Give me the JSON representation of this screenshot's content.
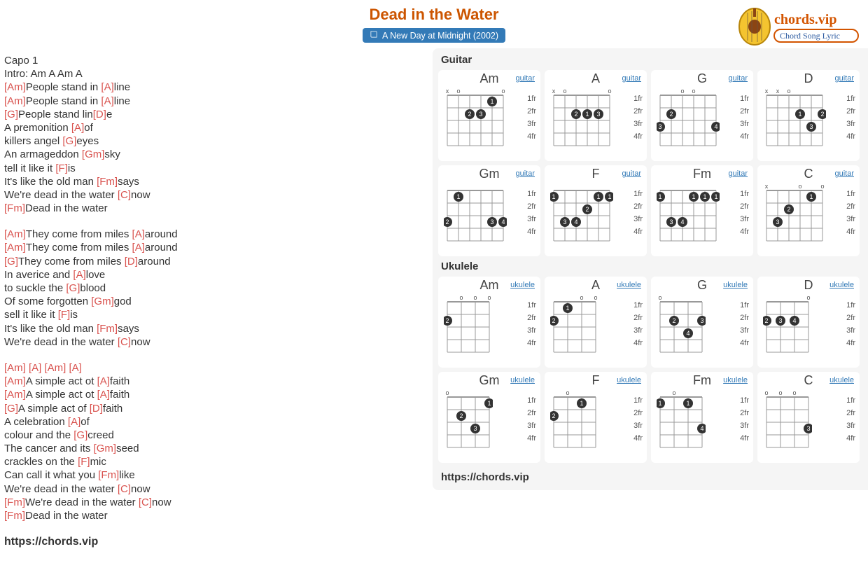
{
  "song": {
    "title": "Dead in the Water",
    "album_line": "A New Day at Midnight (2002)",
    "capo": "Capo 1",
    "intro": "Intro: Am A Am A"
  },
  "verses": [
    [
      {
        "pre": "",
        "chord": "[Am]",
        "post": "People stand in ",
        "chord2": "[A]",
        "post2": "line"
      },
      {
        "pre": "",
        "chord": "[Am]",
        "post": "People stand in ",
        "chord2": "[A]",
        "post2": "line"
      },
      {
        "pre": "",
        "chord": "[G]",
        "post": "People stand lin",
        "chord2": "[D]",
        "post2": "e"
      },
      {
        "pre": "A premonition ",
        "chord": "[A]",
        "post": "of"
      },
      {
        "pre": "killers angel ",
        "chord": "[G]",
        "post": "eyes"
      },
      {
        "pre": "An armageddon ",
        "chord": "[Gm]",
        "post": "sky"
      },
      {
        "pre": "tell it like it ",
        "chord": "[F]",
        "post": "is"
      },
      {
        "pre": "It's like the old man ",
        "chord": "[Fm]",
        "post": "says"
      },
      {
        "pre": "We're dead in the water ",
        "chord": "[C]",
        "post": "now"
      },
      {
        "pre": "",
        "chord": "[Fm]",
        "post": "Dead in the water"
      }
    ],
    [
      {
        "pre": "",
        "chord": "[Am]",
        "post": "They come from miles ",
        "chord2": "[A]",
        "post2": "around"
      },
      {
        "pre": "",
        "chord": "[Am]",
        "post": "They come from miles ",
        "chord2": "[A]",
        "post2": "around"
      },
      {
        "pre": "",
        "chord": "[G]",
        "post": "They come from miles ",
        "chord2": "[D]",
        "post2": "around"
      },
      {
        "pre": "In averice and ",
        "chord": "[A]",
        "post": "love"
      },
      {
        "pre": "to suckle the ",
        "chord": "[G]",
        "post": "blood"
      },
      {
        "pre": "Of some forgotten ",
        "chord": "[Gm]",
        "post": "god"
      },
      {
        "pre": "sell it like it ",
        "chord": "[F]",
        "post": "is"
      },
      {
        "pre": "It's like the old man ",
        "chord": "[Fm]",
        "post": "says"
      },
      {
        "pre": "We're dead in the water ",
        "chord": "[C]",
        "post": "now"
      }
    ],
    [
      {
        "pre": "",
        "chord": "[Am] [A] [Am] [A]",
        "post": ""
      },
      {
        "pre": "",
        "chord": "[Am]",
        "post": "A simple act ot ",
        "chord2": "[A]",
        "post2": "faith"
      },
      {
        "pre": "",
        "chord": "[Am]",
        "post": "A simple act ot ",
        "chord2": "[A]",
        "post2": "faith"
      },
      {
        "pre": "",
        "chord": "[G]",
        "post": "A simple act of ",
        "chord2": "[D]",
        "post2": "faith"
      },
      {
        "pre": "A celebration ",
        "chord": "[A]",
        "post": "of"
      },
      {
        "pre": "colour and the ",
        "chord": "[G]",
        "post": "creed"
      },
      {
        "pre": "The cancer and its ",
        "chord": "[Gm]",
        "post": "seed"
      },
      {
        "pre": "crackles on the ",
        "chord": "[F]",
        "post": "mic"
      },
      {
        "pre": "Can call it what you ",
        "chord": "[Fm]",
        "post": "like"
      },
      {
        "pre": "We're dead in the water ",
        "chord": "[C]",
        "post": "now"
      },
      {
        "pre": "",
        "chord": "[Fm]",
        "post": "We're dead in the water ",
        "chord2": "[C]",
        "post2": "now"
      },
      {
        "pre": "",
        "chord": "[Fm]",
        "post": "Dead in the water"
      }
    ]
  ],
  "footer_url": "https://chords.vip",
  "panel": {
    "guitar_heading": "Guitar",
    "ukulele_heading": "Ukulele",
    "url": "https://chords.vip",
    "type_guitar": "guitar",
    "type_ukulele": "ukulele",
    "fret_labels": [
      "1fr",
      "2fr",
      "3fr",
      "4fr"
    ]
  },
  "guitar_chords": [
    {
      "name": "Am",
      "nut": [
        "x",
        "o",
        "",
        "",
        "",
        "o"
      ],
      "dots": [
        {
          "s": 2,
          "f": 1,
          "n": "1"
        },
        {
          "s": 3,
          "f": 2,
          "n": "3"
        },
        {
          "s": 4,
          "f": 2,
          "n": "2"
        }
      ]
    },
    {
      "name": "A",
      "nut": [
        "x",
        "o",
        "",
        "",
        "",
        "o"
      ],
      "dots": [
        {
          "s": 2,
          "f": 2,
          "n": "3"
        },
        {
          "s": 3,
          "f": 2,
          "n": "1"
        },
        {
          "s": 4,
          "f": 2,
          "n": "2"
        }
      ]
    },
    {
      "name": "G",
      "nut": [
        "",
        "",
        "o",
        "o",
        "",
        ""
      ],
      "dots": [
        {
          "s": 5,
          "f": 2,
          "n": "2"
        },
        {
          "s": 6,
          "f": 3,
          "n": "3"
        },
        {
          "s": 1,
          "f": 3,
          "n": "4"
        }
      ]
    },
    {
      "name": "D",
      "nut": [
        "x",
        "x",
        "o",
        "",
        "",
        ""
      ],
      "dots": [
        {
          "s": 3,
          "f": 2,
          "n": "1"
        },
        {
          "s": 1,
          "f": 2,
          "n": "2"
        },
        {
          "s": 2,
          "f": 3,
          "n": "3"
        }
      ]
    },
    {
      "name": "Gm",
      "nut": [
        "",
        "",
        "",
        "",
        "",
        ""
      ],
      "dots": [
        {
          "s": 5,
          "f": 1,
          "n": "1"
        },
        {
          "s": 6,
          "f": 3,
          "n": "2"
        },
        {
          "s": 2,
          "f": 3,
          "n": "3"
        },
        {
          "s": 1,
          "f": 3,
          "n": "4"
        }
      ]
    },
    {
      "name": "F",
      "nut": [
        "",
        "",
        "",
        "",
        "",
        ""
      ],
      "dots": [
        {
          "s": 6,
          "f": 1,
          "n": "1"
        },
        {
          "s": 2,
          "f": 1,
          "n": "1"
        },
        {
          "s": 1,
          "f": 1,
          "n": "1"
        },
        {
          "s": 3,
          "f": 2,
          "n": "2"
        },
        {
          "s": 5,
          "f": 3,
          "n": "3"
        },
        {
          "s": 4,
          "f": 3,
          "n": "4"
        }
      ]
    },
    {
      "name": "Fm",
      "nut": [
        "",
        "",
        "",
        "",
        "",
        ""
      ],
      "dots": [
        {
          "s": 6,
          "f": 1,
          "n": "1"
        },
        {
          "s": 3,
          "f": 1,
          "n": "1"
        },
        {
          "s": 2,
          "f": 1,
          "n": "1"
        },
        {
          "s": 1,
          "f": 1,
          "n": "1"
        },
        {
          "s": 5,
          "f": 3,
          "n": "3"
        },
        {
          "s": 4,
          "f": 3,
          "n": "4"
        }
      ]
    },
    {
      "name": "C",
      "nut": [
        "x",
        "",
        "",
        "o",
        "",
        "o"
      ],
      "dots": [
        {
          "s": 2,
          "f": 1,
          "n": "1"
        },
        {
          "s": 4,
          "f": 2,
          "n": "2"
        },
        {
          "s": 5,
          "f": 3,
          "n": "3"
        }
      ]
    }
  ],
  "ukulele_chords": [
    {
      "name": "Am",
      "nut": [
        "",
        "o",
        "o",
        "o"
      ],
      "dots": [
        {
          "s": 4,
          "f": 2,
          "n": "2"
        }
      ]
    },
    {
      "name": "A",
      "nut": [
        "",
        "",
        "o",
        "o"
      ],
      "dots": [
        {
          "s": 3,
          "f": 1,
          "n": "1"
        },
        {
          "s": 4,
          "f": 2,
          "n": "2"
        }
      ]
    },
    {
      "name": "G",
      "nut": [
        "o",
        "",
        "",
        ""
      ],
      "dots": [
        {
          "s": 3,
          "f": 2,
          "n": "2"
        },
        {
          "s": 1,
          "f": 2,
          "n": "3"
        },
        {
          "s": 2,
          "f": 3,
          "n": "4"
        }
      ]
    },
    {
      "name": "D",
      "nut": [
        "",
        "",
        "",
        "o"
      ],
      "dots": [
        {
          "s": 4,
          "f": 2,
          "n": "2"
        },
        {
          "s": 3,
          "f": 2,
          "n": "3"
        },
        {
          "s": 2,
          "f": 2,
          "n": "4"
        }
      ]
    },
    {
      "name": "Gm",
      "nut": [
        "o",
        "",
        "",
        ""
      ],
      "dots": [
        {
          "s": 1,
          "f": 1,
          "n": "1"
        },
        {
          "s": 3,
          "f": 2,
          "n": "2"
        },
        {
          "s": 2,
          "f": 3,
          "n": "3"
        }
      ]
    },
    {
      "name": "F",
      "nut": [
        "",
        "o",
        "",
        ""
      ],
      "dots": [
        {
          "s": 2,
          "f": 1,
          "n": "1"
        },
        {
          "s": 4,
          "f": 2,
          "n": "2"
        }
      ]
    },
    {
      "name": "Fm",
      "nut": [
        "",
        "o",
        "",
        ""
      ],
      "dots": [
        {
          "s": 4,
          "f": 1,
          "n": "1"
        },
        {
          "s": 2,
          "f": 1,
          "n": "1"
        },
        {
          "s": 1,
          "f": 3,
          "n": "4"
        }
      ]
    },
    {
      "name": "C",
      "nut": [
        "o",
        "o",
        "o",
        ""
      ],
      "dots": [
        {
          "s": 1,
          "f": 3,
          "n": "3"
        }
      ]
    }
  ],
  "logo": {
    "text_top": "chords.vip",
    "text_bottom": "Chord Song Lyric"
  }
}
